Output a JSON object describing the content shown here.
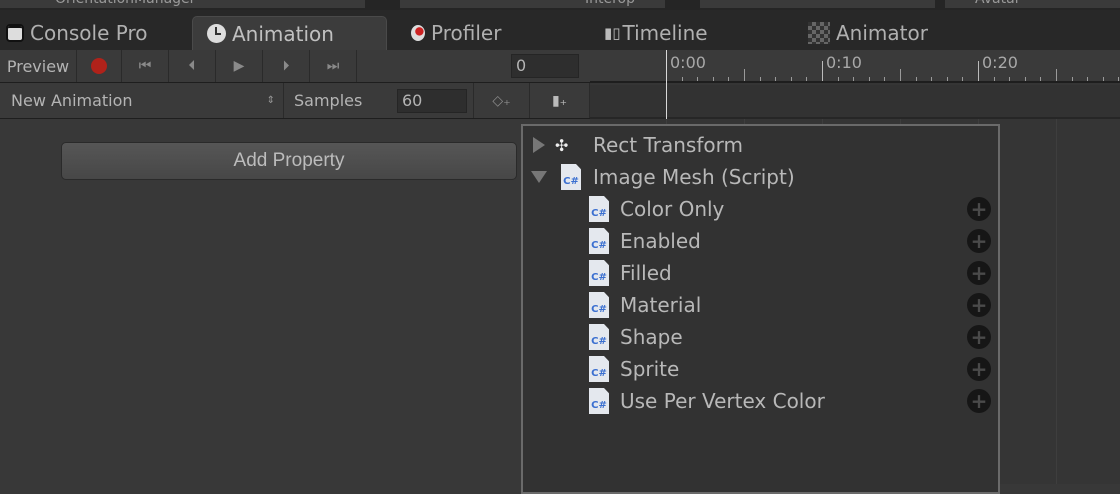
{
  "top_strip": {
    "fields": [
      "OrientationManager",
      "Interop",
      "Avatar"
    ]
  },
  "tabs": [
    {
      "label": "Console Pro",
      "icon": "console-icon"
    },
    {
      "label": "Animation",
      "icon": "clock-icon",
      "active": true
    },
    {
      "label": "Profiler",
      "icon": "profiler-icon"
    },
    {
      "label": "Timeline",
      "icon": "timeline-icon"
    },
    {
      "label": "Animator",
      "icon": "animator-icon"
    }
  ],
  "toolbar": {
    "preview_label": "Preview",
    "frame_value": "0",
    "clip_name": "New Animation",
    "samples_label": "Samples",
    "samples_value": "60"
  },
  "timeline": {
    "ruler_labels": [
      "0:00",
      "0:10",
      "0:20"
    ]
  },
  "add_property_label": "Add Property",
  "popup": {
    "groups": [
      {
        "label": "Rect Transform",
        "expanded": false
      },
      {
        "label": "Image Mesh (Script)",
        "expanded": true
      }
    ],
    "icon_text": "C#",
    "properties": [
      "Color Only",
      "Enabled",
      "Filled",
      "Material",
      "Shape",
      "Sprite",
      "Use Per Vertex Color"
    ]
  },
  "colors": {
    "record": "#b0221a",
    "script_icon": "#3a6fd0"
  }
}
